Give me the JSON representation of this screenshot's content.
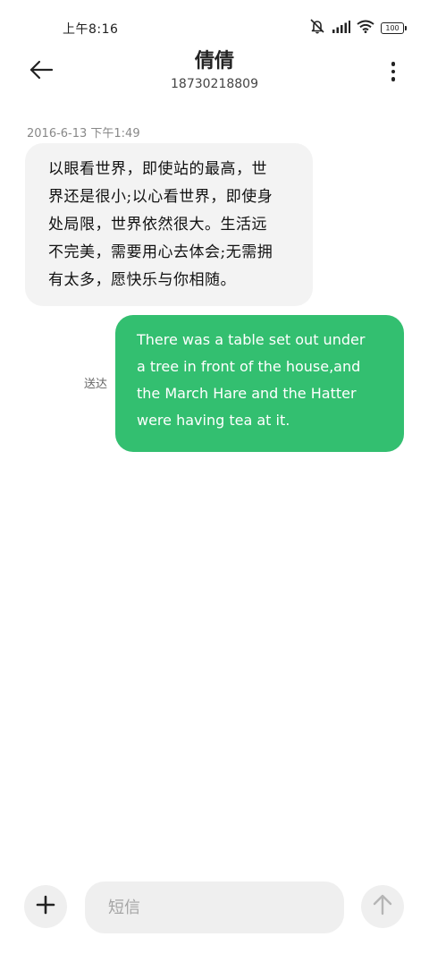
{
  "status_bar": {
    "time": "上午8:16",
    "battery_level": "100",
    "icons": [
      "mute-bell-icon",
      "signal-icon",
      "wifi-icon",
      "battery-icon"
    ]
  },
  "header": {
    "back_icon": "back-arrow-icon",
    "contact_name": "倩倩",
    "contact_number": "18730218809",
    "more_icon": "more-vertical-icon"
  },
  "conversation": {
    "timestamp": "2016-6-13 下午1:49",
    "messages": [
      {
        "direction": "incoming",
        "lines": [
          "以眼看世界，即使站的最高，世",
          "界还是很小;以心看世界，即使身",
          "处局限，世界依然很大。生活远",
          "不完美，需要用心去体会;无需拥",
          "有太多，愿快乐与你相随。"
        ]
      },
      {
        "direction": "outgoing",
        "status": "送达",
        "lines": [
          "There was a table set out under",
          "a tree in front of the house,and",
          "the March Hare and the Hatter",
          "were having tea at it."
        ]
      }
    ]
  },
  "input_bar": {
    "add_icon": "plus-icon",
    "placeholder": "短信",
    "send_icon": "send-arrow-up-icon"
  },
  "colors": {
    "outgoing_bubble": "#33bf70",
    "incoming_bubble": "#f3f3f3"
  }
}
